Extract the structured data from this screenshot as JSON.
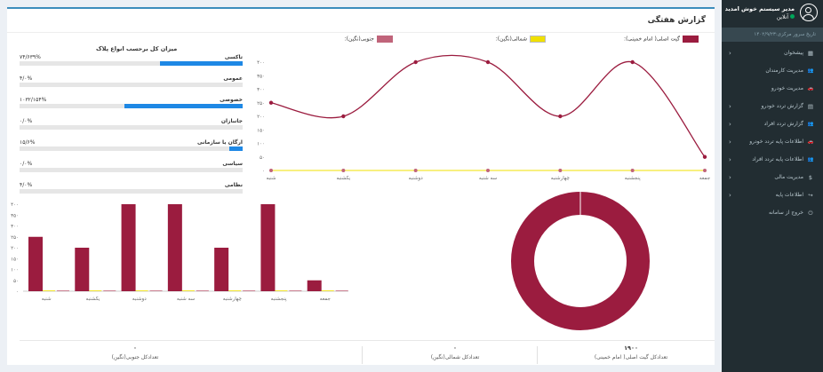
{
  "header": {
    "title": "گزارش هفتگی"
  },
  "sidebar": {
    "user_name": "مدیر سیستم خوش امدید",
    "status": "آنلاین",
    "date_label": "تاریخ سرور مرکزی:۱۴۰۲/۹/۲۳",
    "items": [
      {
        "label": "پیشخوان",
        "icon": "dashboard-icon",
        "has_children": true
      },
      {
        "label": "مدیریت کارمندان",
        "icon": "users-icon",
        "has_children": false
      },
      {
        "label": "مدیریت خودرو",
        "icon": "car-icon",
        "has_children": false
      },
      {
        "label": "گزارش تردد خودرو",
        "icon": "chart-icon",
        "has_children": true
      },
      {
        "label": "گزارش تردد افراد",
        "icon": "users-icon",
        "has_children": true
      },
      {
        "label": "اطلاعات پایه تردد خودرو",
        "icon": "car-icon",
        "has_children": true
      },
      {
        "label": "اطلاعات پایه تردد افراد",
        "icon": "users-icon",
        "has_children": true
      },
      {
        "label": "مدیریت مالی",
        "icon": "dollar-icon",
        "has_children": true
      },
      {
        "label": "اطلاعات پایه",
        "icon": "share-icon",
        "has_children": true
      },
      {
        "label": "خروج از سامانه",
        "icon": "exit-icon",
        "has_children": false
      }
    ]
  },
  "colors": {
    "series_main": "#9b1c3f",
    "series_north": "#f0e000",
    "series_south": "#c0647a",
    "progress": "#1e88e5",
    "sidebar": "#222d32"
  },
  "plate_chart": {
    "title": "میزان کل برحسب انواع پلاک",
    "rows": [
      {
        "label": "تاکسی",
        "value": "۷۴/۶۳۹%",
        "pct": 0.37
      },
      {
        "label": "عمومی",
        "value": "۴/۰%",
        "pct": 0
      },
      {
        "label": "خصوصی",
        "value": "۱۰۳۲/۱۵۴%",
        "pct": 0.53
      },
      {
        "label": "جانبازان",
        "value": "۰/۰%",
        "pct": 0
      },
      {
        "label": "ارگان یا سازمانی",
        "value": "۱۵/۶%",
        "pct": 0.06
      },
      {
        "label": "سیاسی",
        "value": "۰/۰%",
        "pct": 0
      },
      {
        "label": "نظامی",
        "value": "۴/۰%",
        "pct": 0
      }
    ]
  },
  "chart_data": [
    {
      "type": "line",
      "categories": [
        "شنبه",
        "یکشنبه",
        "دوشنبه",
        "سه شنبه",
        "چهارشنبه",
        "پنجشنبه",
        "جمعه"
      ],
      "series": [
        {
          "name": "گیت اصلی( امام خمینی)",
          "values": [
            250,
            200,
            400,
            400,
            200,
            400,
            50
          ]
        },
        {
          "name": "شمالی(نگین)",
          "values": [
            0,
            0,
            0,
            0,
            0,
            0,
            0
          ]
        },
        {
          "name": "جنوبی(نگین)",
          "values": [
            0,
            0,
            0,
            0,
            0,
            0,
            0
          ]
        }
      ],
      "ylim": [
        0,
        400
      ],
      "yticks": [
        "۰",
        "۵۰",
        "۱۰۰",
        "۱۵۰",
        "۲۰۰",
        "۲۵۰",
        "۳۰۰",
        "۳۵۰",
        "۴۰۰"
      ],
      "legend": "top"
    },
    {
      "type": "bar",
      "categories": [
        "شنبه",
        "یکشنبه",
        "دوشنبه",
        "سه شنبه",
        "چهارشنبه",
        "پنجشنبه",
        "جمعه"
      ],
      "series": [
        {
          "name": "گیت اصلی( امام خمینی)",
          "values": [
            250,
            200,
            400,
            400,
            200,
            400,
            50
          ]
        },
        {
          "name": "شمالی(نگین)",
          "values": [
            0,
            0,
            0,
            0,
            0,
            0,
            0
          ]
        },
        {
          "name": "جنوبی(نگین)",
          "values": [
            0,
            0,
            0,
            0,
            0,
            0,
            0
          ]
        }
      ],
      "ylim": [
        0,
        400
      ],
      "yticks": [
        "۰",
        "۵۰",
        "۱۰۰",
        "۱۵۰",
        "۲۰۰",
        "۲۵۰",
        "۳۰۰",
        "۳۵۰",
        "۴۰۰"
      ]
    },
    {
      "type": "pie",
      "categories": [
        "گیت اصلی( امام خمینی)",
        "شمالی(نگین)",
        "جنوبی(نگین)"
      ],
      "values": [
        1900,
        0,
        0
      ]
    }
  ],
  "totals": [
    {
      "label": "تعدادکل جنوبی(نگین)",
      "value": "۰"
    },
    {
      "label": "تعدادکل شمالی(نگین)",
      "value": "۰"
    },
    {
      "label": "تعدادکل گیت اصلی( امام خمینی)",
      "value": "۱۹۰۰"
    }
  ]
}
